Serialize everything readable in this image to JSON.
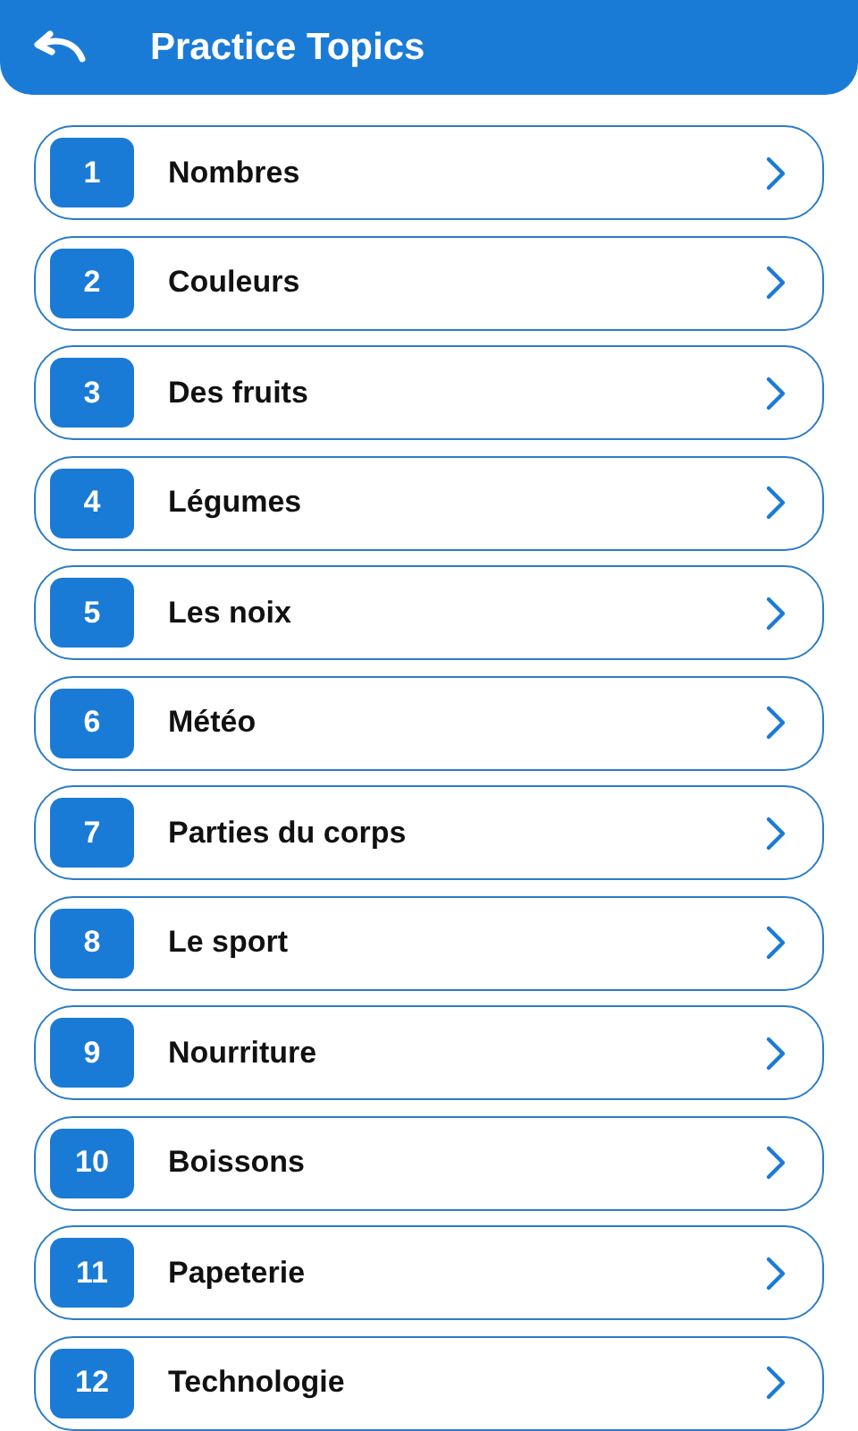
{
  "header": {
    "title": "Practice Topics"
  },
  "topics": [
    {
      "number": "1",
      "label": "Nombres"
    },
    {
      "number": "2",
      "label": "Couleurs"
    },
    {
      "number": "3",
      "label": "Des fruits"
    },
    {
      "number": "4",
      "label": "Légumes"
    },
    {
      "number": "5",
      "label": "Les noix"
    },
    {
      "number": "6",
      "label": "Météo"
    },
    {
      "number": "7",
      "label": "Parties du corps"
    },
    {
      "number": "8",
      "label": "Le sport"
    },
    {
      "number": "9",
      "label": "Nourriture"
    },
    {
      "number": "10",
      "label": "Boissons"
    },
    {
      "number": "11",
      "label": "Papeterie"
    },
    {
      "number": "12",
      "label": "Technologie"
    }
  ]
}
